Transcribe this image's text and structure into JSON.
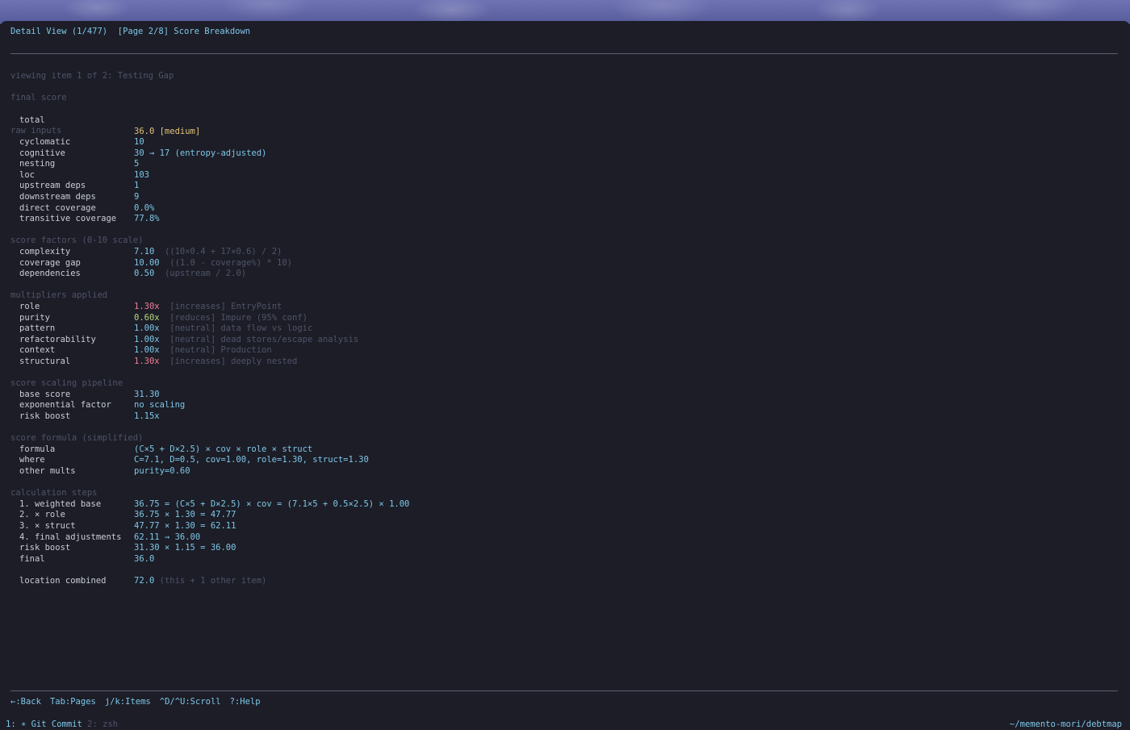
{
  "header": {
    "title": "Detail View (1/477)",
    "page": "[Page 2/8] Score Breakdown"
  },
  "viewing": "viewing item 1 of 2: Testing Gap",
  "sections": {
    "final_score": {
      "heading": "final score",
      "total_label": "total",
      "total_value": "36.0 [medium]"
    },
    "raw_inputs": {
      "heading": "raw inputs",
      "rows": [
        {
          "label": "cyclomatic",
          "value": "10"
        },
        {
          "label": "cognitive",
          "value": "30 → 17 (entropy-adjusted)"
        },
        {
          "label": "nesting",
          "value": "5"
        },
        {
          "label": "loc",
          "value": "103"
        },
        {
          "label": "upstream deps",
          "value": "1"
        },
        {
          "label": "downstream deps",
          "value": "9"
        },
        {
          "label": "direct coverage",
          "value": "0.0%"
        },
        {
          "label": "transitive coverage",
          "value": "77.8%"
        }
      ]
    },
    "score_factors": {
      "heading": "score factors (0-10 scale)",
      "rows": [
        {
          "label": "complexity",
          "value": "7.10",
          "note": "((10×0.4 + 17×0.6) / 2)"
        },
        {
          "label": "coverage gap",
          "value": "10.00",
          "note": "((1.0 - coverage%) * 10)"
        },
        {
          "label": "dependencies",
          "value": "0.50",
          "note": "(upstream / 2.0)"
        }
      ]
    },
    "multipliers": {
      "heading": "multipliers applied",
      "rows": [
        {
          "label": "role",
          "value": "1.30x",
          "note": "[increases] EntryPoint"
        },
        {
          "label": "purity",
          "value": "0.60x",
          "note": "[reduces] Impure (95% conf)"
        },
        {
          "label": "pattern",
          "value": "1.00x",
          "note": "[neutral] data flow vs logic"
        },
        {
          "label": "refactorability",
          "value": "1.00x",
          "note": "[neutral] dead stores/escape analysis"
        },
        {
          "label": "context",
          "value": "1.00x",
          "note": "[neutral] Production"
        },
        {
          "label": "structural",
          "value": "1.30x",
          "note": "[increases] deeply nested"
        }
      ]
    },
    "scaling": {
      "heading": "score scaling pipeline",
      "rows": [
        {
          "label": "base score",
          "value": "31.30"
        },
        {
          "label": "exponential factor",
          "value": "no scaling"
        },
        {
          "label": "risk boost",
          "value": "1.15x"
        }
      ]
    },
    "formula": {
      "heading": "score formula (simplified)",
      "rows": [
        {
          "label": "formula",
          "value": "(C×5 + D×2.5) × cov × role × struct"
        },
        {
          "label": "where",
          "value": "C=7.1, D=0.5, cov=1.00, role=1.30, struct=1.30"
        },
        {
          "label": "other mults",
          "value": "purity=0.60"
        }
      ]
    },
    "steps": {
      "heading": "calculation steps",
      "rows": [
        {
          "label": "1. weighted base",
          "value": "36.75 = (C×5 + D×2.5) × cov = (7.1×5 + 0.5×2.5) × 1.00"
        },
        {
          "label": "2. × role",
          "value": "36.75 × 1.30 = 47.77"
        },
        {
          "label": "3. × struct",
          "value": "47.77 × 1.30 = 62.11"
        },
        {
          "label": "4. final adjustments",
          "value": "62.11 → 36.00"
        },
        {
          "label": "risk boost",
          "value": "31.30 × 1.15 = 36.00"
        },
        {
          "label": "final",
          "value": "36.0"
        }
      ]
    },
    "location": {
      "label": "location combined",
      "value": "72.0",
      "note": "(this + 1 other item)"
    }
  },
  "footer": {
    "keys": [
      "←:Back",
      "Tab:Pages",
      "j/k:Items",
      "^D/^U:Scroll",
      "?:Help"
    ]
  },
  "statusbar": {
    "window1": "1: ∗ Git Commit",
    "window2": "2: zsh",
    "path": "~/memento-mori/debtmap"
  },
  "colors": {
    "background": "#1c1d27",
    "value_blue": "#7fc7e8",
    "section_gray": "#4f5468",
    "medium_yellow": "#e3c27a",
    "increase_red": "#ef7f96",
    "reduce_green": "#b8d87c"
  }
}
